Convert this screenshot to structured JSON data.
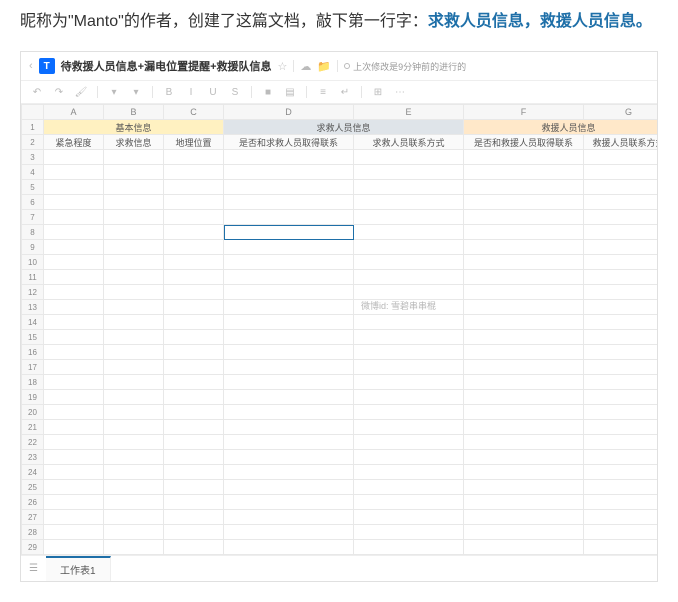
{
  "caption": {
    "prefix": "昵称为\"Manto\"的作者，创建了这篇文档，敲下第一行字：",
    "highlight": "求救人员信息，救援人员信息。"
  },
  "doc": {
    "title": "待救援人员信息+漏电位置提醒+救援队信息",
    "upload_hint": "上次修改是9分钟前的进行的"
  },
  "columns": [
    "A",
    "B",
    "C",
    "D",
    "E",
    "F",
    "G"
  ],
  "groups": {
    "basic": "基本信息",
    "rescue": "求救人员信息",
    "team": "救援人员信息"
  },
  "headers": {
    "a": "紧急程度",
    "b": "求救信息",
    "c": "地理位置",
    "d": "是否和求救人员取得联系",
    "e": "求救人员联系方式",
    "f": "是否和救援人员取得联系",
    "g": "救援人员联系方式"
  },
  "watermark": "微博id: 雪碧串串棍",
  "row_count": 29,
  "selected_row": 8,
  "sheet_tab": "工作表1",
  "chart_data": {
    "type": "table",
    "title": "待救援人员信息+漏电位置提醒+救援队信息",
    "column_groups": [
      {
        "name": "基本信息",
        "columns": [
          "紧急程度",
          "求救信息",
          "地理位置"
        ]
      },
      {
        "name": "求救人员信息",
        "columns": [
          "是否和求救人员取得联系",
          "求救人员联系方式"
        ]
      },
      {
        "name": "救援人员信息",
        "columns": [
          "是否和救援人员取得联系",
          "救援人员联系方式"
        ]
      }
    ],
    "rows": []
  }
}
